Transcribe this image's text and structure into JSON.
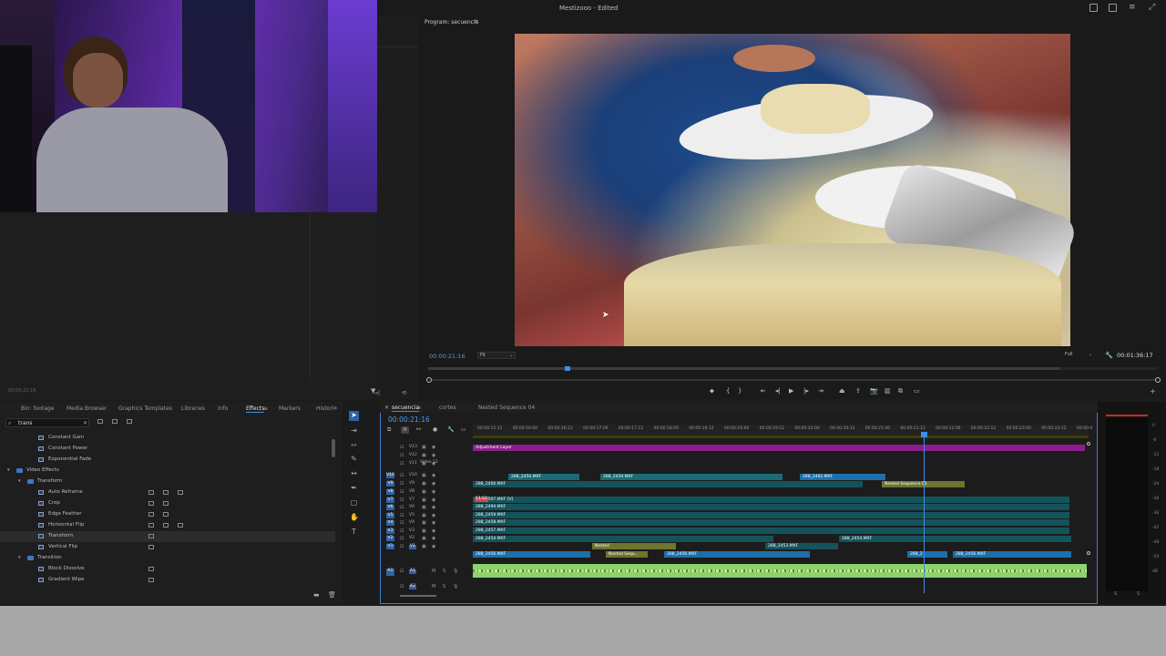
{
  "window": {
    "title": "Mestizooo - Edited"
  },
  "program": {
    "label": "Program: secuencia",
    "timecode": "00:00:21:16",
    "fit": "Fit",
    "quality": "Full",
    "duration": "00:01:36:17"
  },
  "left_panel": {
    "timecode": "00:00:21:16",
    "tabs": [
      "Bin: footage",
      "Media Browser",
      "Graphics Templates",
      "Libraries",
      "Info",
      "Effects",
      "Markers",
      "Histori"
    ],
    "active_tab": "Effects"
  },
  "effects": {
    "search_value": "trans",
    "items": [
      {
        "label": "Constant Gain",
        "type": "fx",
        "indent": 2,
        "badges": 0
      },
      {
        "label": "Constant Power",
        "type": "fx",
        "indent": 2,
        "badges": 0
      },
      {
        "label": "Exponential Fade",
        "type": "fx",
        "indent": 2,
        "badges": 0
      },
      {
        "label": "Video Effects",
        "type": "folder",
        "indent": 0,
        "badges": 0
      },
      {
        "label": "Transform",
        "type": "folder",
        "indent": 1,
        "badges": 0
      },
      {
        "label": "Auto Reframe",
        "type": "fx",
        "indent": 2,
        "badges": 3
      },
      {
        "label": "Crop",
        "type": "fx",
        "indent": 2,
        "badges": 2
      },
      {
        "label": "Edge Feather",
        "type": "fx",
        "indent": 2,
        "badges": 2
      },
      {
        "label": "Horizontal Flip",
        "type": "fx",
        "indent": 2,
        "badges": 3
      },
      {
        "label": "Transform",
        "type": "fx",
        "indent": 2,
        "badges": 1,
        "selected": true
      },
      {
        "label": "Vertical Flip",
        "type": "fx",
        "indent": 2,
        "badges": 1
      },
      {
        "label": "Transition",
        "type": "folder",
        "indent": 1,
        "badges": 0
      },
      {
        "label": "Block Dissolve",
        "type": "fx",
        "indent": 2,
        "badges": 1
      },
      {
        "label": "Gradient Wipe",
        "type": "fx",
        "indent": 2,
        "badges": 1
      }
    ]
  },
  "timeline": {
    "tabs": [
      "secuencia",
      "cortes",
      "Nested Sequence 04"
    ],
    "active_tab": "secuencia",
    "timecode": "00:00:21:16",
    "ruler": [
      "00:00:15:12",
      "00:00:16:00",
      "00:00:16:12",
      "00:00:17:00",
      "00:00:17:12",
      "00:00:18:00",
      "00:00:18:12",
      "00:00:19:00",
      "00:00:19:12",
      "00:00:20:00",
      "00:00:20:12",
      "00:00:21:00",
      "00:00:21:12",
      "00:00:22:00",
      "00:00:22:12",
      "00:00:23:00",
      "00:00:23:12",
      "00:00:0"
    ],
    "tracks": [
      {
        "src": "",
        "name": "V13"
      },
      {
        "src": "",
        "name": "V12",
        "label": "Video 12"
      },
      {
        "src": "",
        "name": "V11"
      },
      {
        "src": "V10",
        "name": "V10"
      },
      {
        "src": "V9",
        "name": "V9"
      },
      {
        "src": "V8",
        "name": "V8"
      },
      {
        "src": "V7",
        "name": "V7"
      },
      {
        "src": "V6",
        "name": "V6"
      },
      {
        "src": "V5",
        "name": "V5"
      },
      {
        "src": "V4",
        "name": "V4"
      },
      {
        "src": "V3",
        "name": "V3"
      },
      {
        "src": "V2",
        "name": "V2"
      },
      {
        "src": "V1",
        "name": "V1"
      }
    ],
    "audio_tracks": [
      {
        "src": "A1",
        "name": "A1"
      },
      {
        "src": "",
        "name": "A2"
      }
    ],
    "clip_labels": {
      "adjustment": "Adjustment Layer",
      "v11a": "288_2450.MXF",
      "v11b": "288_2450.MXF",
      "v11c": "288_2462.MXF",
      "v10a": "288_2400.MXF",
      "v10b": "Nested Sequence 05",
      "v8": "288_2507.MXF [V]",
      "v7": "288_2494.MXF",
      "v6": "288_2459.MXF",
      "v5": "288_2458.MXF",
      "v4": "288_2457.MXF",
      "v3a": "288_2454.MXF",
      "v3b": "288_2454.MXF",
      "v2a": "Nested",
      "v2b": "288_2453.MXF",
      "v1a": "288_2456.MXF",
      "v1b": "Nested Sequ...",
      "v1c": "288_2456.MXF",
      "v1d": "288_2",
      "v1e": "288_2456.MXF",
      "v8badge": "11:02"
    }
  },
  "meter": {
    "scale": [
      "0",
      "-6",
      "-12",
      "-18",
      "-24",
      "-30",
      "-36",
      "-42",
      "-48",
      "-54",
      "dB"
    ],
    "labels": [
      "S",
      "S"
    ]
  }
}
